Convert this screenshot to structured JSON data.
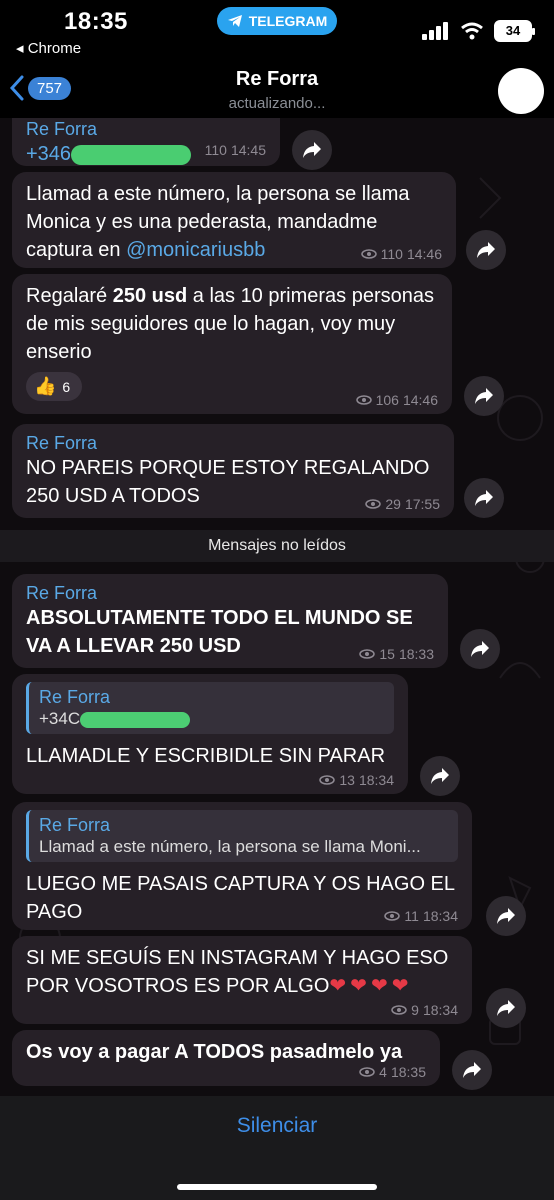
{
  "status_bar": {
    "time": "18:35",
    "back_app": "◂ Chrome",
    "telegram_pill": "TELEGRAM",
    "battery": "34"
  },
  "header": {
    "back_count": "757",
    "title": "Re Forra",
    "subtitle": "actualizando..."
  },
  "messages": [
    {
      "sender": "Re Forra",
      "number_prefix": "+346",
      "views": "110",
      "time": "14:45"
    },
    {
      "text_before_link": "Llamad a este número, la persona se llama Monica y es una pederasta, mandadme captura en ",
      "link": "@monicariusbb",
      "views": "110",
      "time": "14:46"
    },
    {
      "text_a": "Regalaré ",
      "text_bold": "250 usd",
      "text_b": " a las 10 primeras personas de mis seguidores que lo hagan, voy muy enserio",
      "reaction_emoji": "👍",
      "reaction_count": "6",
      "views": "106",
      "time": "14:46"
    },
    {
      "sender": "Re Forra",
      "text": "NO PAREIS PORQUE ESTOY REGALANDO 250 USD A TODOS",
      "views": "29",
      "time": "17:55"
    },
    {
      "sender": "Re Forra",
      "text": "ABSOLUTAMENTE TODO EL MUNDO SE VA A LLEVAR 250 USD",
      "views": "15",
      "time": "18:33"
    },
    {
      "reply_sender": "Re Forra",
      "reply_text": "+34C",
      "text": "LLAMADLE Y ESCRIBIDLE SIN PARAR",
      "views": "13",
      "time": "18:34"
    },
    {
      "reply_sender": "Re Forra",
      "reply_text": "Llamad a este número, la persona se llama Moni...",
      "text": "LUEGO ME PASAIS CAPTURA Y OS HAGO EL PAGO",
      "views": "11",
      "time": "18:34"
    },
    {
      "text": "SI ME SEGUÍS EN INSTAGRAM Y HAGO ESO POR VOSOTROS ES POR ALGO",
      "hearts": "❤❤❤❤",
      "views": "9",
      "time": "18:34"
    },
    {
      "text": "Os voy a pagar A TODOS pasadmelo ya",
      "views": "4",
      "time": "18:35"
    }
  ],
  "unread_label": "Mensajes no leídos",
  "bottom": {
    "mute_label": "Silenciar"
  },
  "colors": {
    "accent": "#3e8ee8",
    "bubble": "#262027",
    "link": "#5aa9e6",
    "telegram": "#2aa3ef"
  }
}
